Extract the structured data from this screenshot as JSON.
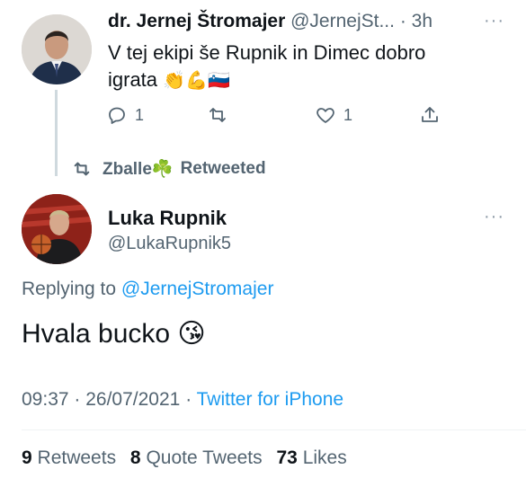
{
  "quoted_tweet": {
    "author_name": "dr. Jernej Štromajer",
    "author_handle": "@JernejSt...",
    "time": "· 3h",
    "more": "···",
    "text_line1": "V tej ekipi še Rupnik in Dimec dobro",
    "text_line2": "igrata",
    "emojis": "👏💪🇸🇮",
    "reply_count": "1",
    "retweet_count": "",
    "like_count": "1"
  },
  "retweet_banner": {
    "user": "Zballe☘️",
    "label": "Retweeted"
  },
  "main_tweet": {
    "author_name": "Luka Rupnik",
    "author_handle": "@LukaRupnik5",
    "more": "···",
    "replying_prefix": "Replying to",
    "replying_to": "@JernejStromajer",
    "text": "Hvala bucko 😘",
    "time": "09:37",
    "date": "26/07/2021",
    "source": "Twitter for iPhone"
  },
  "stats": {
    "retweets_count": "9",
    "retweets_label": "Retweets",
    "quotes_count": "8",
    "quotes_label": "Quote Tweets",
    "likes_count": "73",
    "likes_label": "Likes"
  },
  "colors": {
    "link": "#1d9bf0",
    "secondary": "#536471",
    "primary": "#0f1419"
  }
}
